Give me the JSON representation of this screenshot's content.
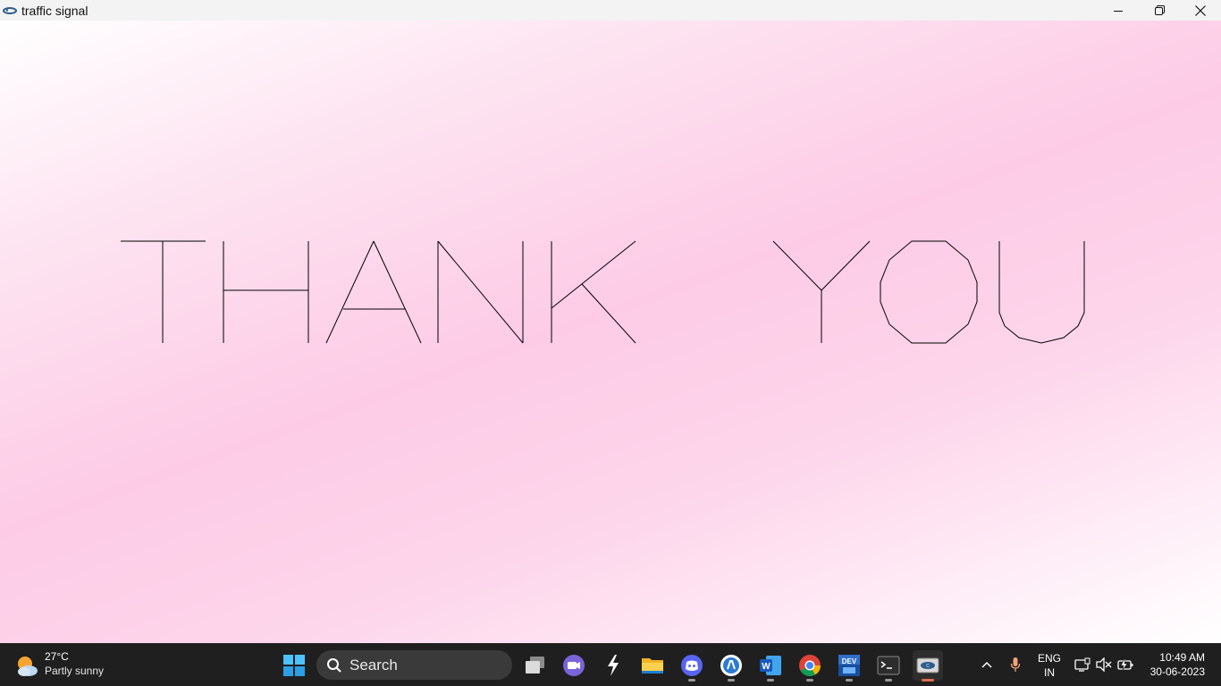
{
  "window": {
    "title": "traffic signal",
    "icon": "turbo-c-graphics-icon",
    "controls": [
      "minimize-icon",
      "restore-icon",
      "close-icon"
    ]
  },
  "canvas": {
    "message": "THANK YOU",
    "background_colors": [
      "#ffffff",
      "#fdcbe6",
      "#ffffff"
    ],
    "stroke_color": "#000000"
  },
  "taskbar": {
    "weather": {
      "temperature": "27°C",
      "condition": "Partly sunny",
      "icon": "partly-sunny-icon"
    },
    "search": {
      "placeholder": "Search"
    },
    "apps": [
      {
        "name": "task-view",
        "icon": "task-view-icon"
      },
      {
        "name": "teams-chat",
        "icon": "video-chat-icon"
      },
      {
        "name": "stripe-app",
        "icon": "lightning-icon"
      },
      {
        "name": "file-explorer",
        "icon": "folder-icon"
      },
      {
        "name": "discord",
        "icon": "discord-icon"
      },
      {
        "name": "signal-app",
        "icon": "signal-icon"
      },
      {
        "name": "word",
        "icon": "word-icon",
        "badge": "W"
      },
      {
        "name": "chrome",
        "icon": "chrome-icon"
      },
      {
        "name": "dev-cpp",
        "icon": "dev-cpp-icon",
        "badge": "DEV"
      },
      {
        "name": "terminal",
        "icon": "terminal-icon"
      },
      {
        "name": "turbo-c",
        "icon": "turbo-c-icon",
        "active": true
      }
    ],
    "tray": {
      "language_line1": "ENG",
      "language_line2": "IN",
      "time": "10:49 AM",
      "date": "30-06-2023"
    }
  }
}
